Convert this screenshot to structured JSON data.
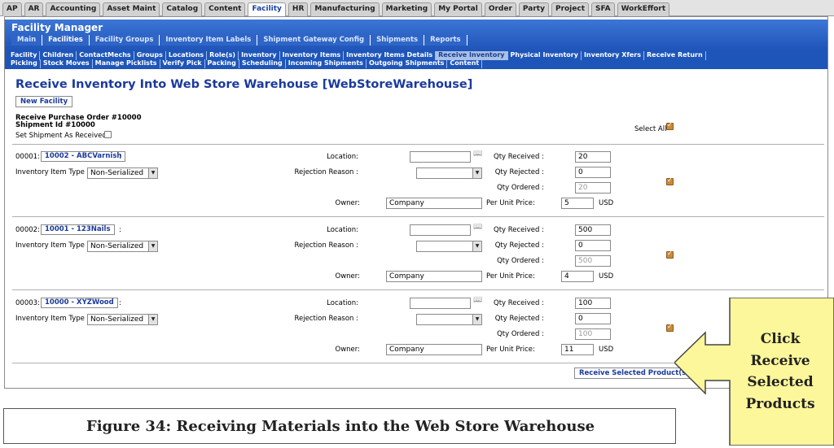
{
  "app_tabs": [
    "AP",
    "AR",
    "Accounting",
    "Asset Maint",
    "Catalog",
    "Content",
    "Facility",
    "HR",
    "Manufacturing",
    "Marketing",
    "My Portal",
    "Order",
    "Party",
    "Project",
    "SFA",
    "WorkEffort"
  ],
  "app_tabs_selected": "Facility",
  "manager": {
    "title": "Facility Manager",
    "menu": [
      "Main",
      "Facilities",
      "Facility Groups",
      "Inventory Item Labels",
      "Shipment Gateway Config",
      "Shipments",
      "Reports"
    ],
    "menu_selected": "Facilities"
  },
  "submenu": {
    "row1": [
      "Facility",
      "Children",
      "ContactMechs",
      "Groups",
      "Locations",
      "Role(s)",
      "Inventory",
      "Inventory Items",
      "Inventory Items Details",
      "Receive Inventory",
      "Physical Inventory",
      "Inventory Xfers",
      "Receive Return"
    ],
    "row2": [
      "Picking",
      "Stock Moves",
      "Manage Picklists",
      "Verify Pick",
      "Packing",
      "Scheduling",
      "Incoming Shipments",
      "Outgoing Shipments",
      "Content"
    ],
    "selected": "Receive Inventory"
  },
  "page": {
    "title": "Receive Inventory Into Web Store Warehouse [WebStoreWarehouse]",
    "new_facility_label": "New Facility",
    "purchase_order": "Receive Purchase Order #10000",
    "shipment_id": "Shipment Id #10000",
    "set_shipment_label": "Set Shipment As Received",
    "select_all_label": "Select All",
    "receive_button": "Receive Selected Product(s)"
  },
  "labels": {
    "inventory_item_type": "Inventory Item Type :",
    "location": "Location:",
    "rejection_reason": "Rejection Reason :",
    "owner": "Owner:",
    "qty_received": "Qty Received :",
    "qty_rejected": "Qty Rejected :",
    "qty_ordered": "Qty Ordered :",
    "per_unit_price": "Per Unit Price:",
    "currency": "USD"
  },
  "items": [
    {
      "seq": "00001:",
      "product": "10002 - ABCVarnish",
      "suffix": ":",
      "item_type": "Non-Serialized",
      "location": "",
      "rejection": "",
      "owner": "Company",
      "qty_received": "20",
      "qty_rejected": "0",
      "qty_ordered": "20",
      "unit_price": "5"
    },
    {
      "seq": "00002:",
      "product": "10001 - 123Nails",
      "suffix": ":",
      "item_type": "Non-Serialized",
      "location": "",
      "rejection": "",
      "owner": "Company",
      "qty_received": "500",
      "qty_rejected": "0",
      "qty_ordered": "500",
      "unit_price": "4"
    },
    {
      "seq": "00003:",
      "product": "10000 - XYZWood",
      "suffix": ":",
      "item_type": "Non-Serialized",
      "location": "",
      "rejection": "",
      "owner": "Company",
      "qty_received": "100",
      "qty_rejected": "0",
      "qty_ordered": "100",
      "unit_price": "11"
    }
  ],
  "caption": "Figure 34: Receiving Materials into the Web Store Warehouse",
  "callout": {
    "lines": [
      "Click",
      "Receive",
      "Selected",
      "Products"
    ],
    "fill": "#fbf79a"
  },
  "colors": {
    "header_blue": "#1f54b8",
    "title_blue": "#1a3a9c",
    "checkbox_checked": "#c98a3c"
  }
}
